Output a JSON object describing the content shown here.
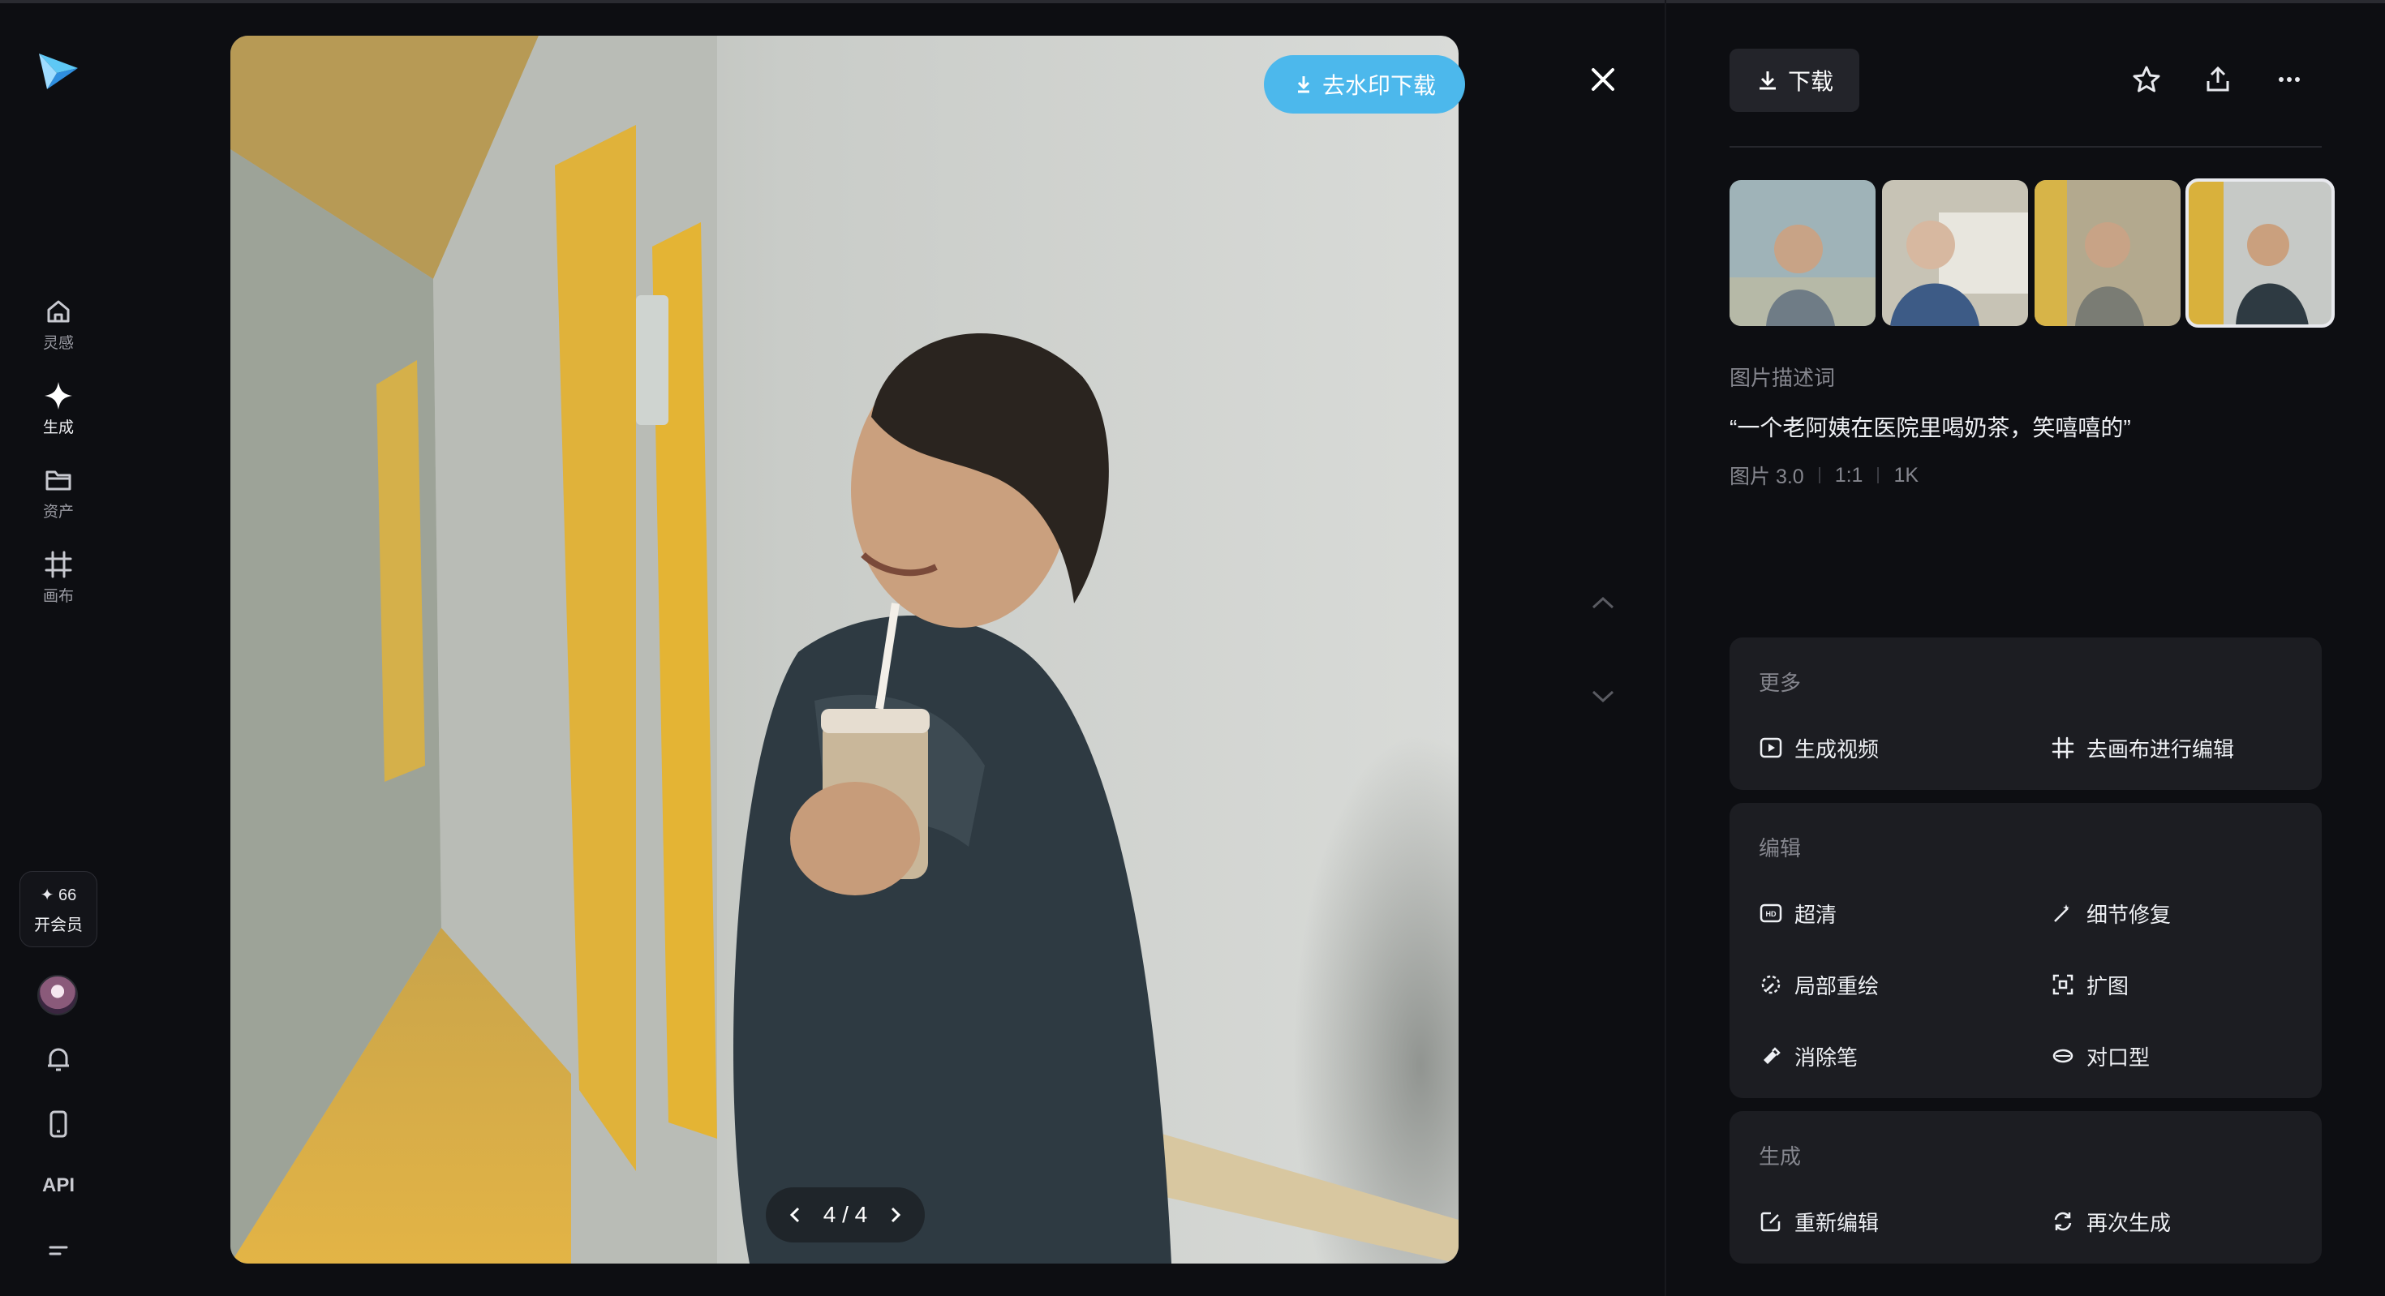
{
  "nav": {
    "items": [
      {
        "label": "灵感",
        "icon": "home-icon"
      },
      {
        "label": "生成",
        "icon": "sparkle-icon"
      },
      {
        "label": "资产",
        "icon": "folder-icon"
      },
      {
        "label": "画布",
        "icon": "canvas-icon"
      }
    ],
    "points": "✦ 66",
    "member_label": "开会员",
    "api_label": "API"
  },
  "viewer": {
    "watermark_download_label": "去水印下载",
    "page_indicator": "4 / 4"
  },
  "panel": {
    "download_label": "下载",
    "description_label": "图片描述词",
    "prompt": "“一个老阿姨在医院里喝奶茶，笑嘻嘻的”",
    "meta": [
      "图片 3.0",
      "1:1",
      "1K"
    ],
    "sections": [
      {
        "title": "更多",
        "actions": [
          {
            "label": "生成视频",
            "icon": "play-video-icon"
          },
          {
            "label": "去画布进行编辑",
            "icon": "canvas-icon"
          }
        ]
      },
      {
        "title": "编辑",
        "actions": [
          {
            "label": "超清",
            "icon": "hd-icon"
          },
          {
            "label": "细节修复",
            "icon": "magic-wand-icon"
          },
          {
            "label": "局部重绘",
            "icon": "partial-repaint-icon"
          },
          {
            "label": "扩图",
            "icon": "expand-icon"
          },
          {
            "label": "消除笔",
            "icon": "eraser-icon"
          },
          {
            "label": "对口型",
            "icon": "lip-sync-icon"
          }
        ]
      },
      {
        "title": "生成",
        "actions": [
          {
            "label": "重新编辑",
            "icon": "re-edit-icon"
          },
          {
            "label": "再次生成",
            "icon": "regenerate-icon"
          }
        ]
      }
    ]
  },
  "colors": {
    "accent": "#4cb8ec",
    "background": "#0d0e12",
    "card": "#1c1d22"
  }
}
